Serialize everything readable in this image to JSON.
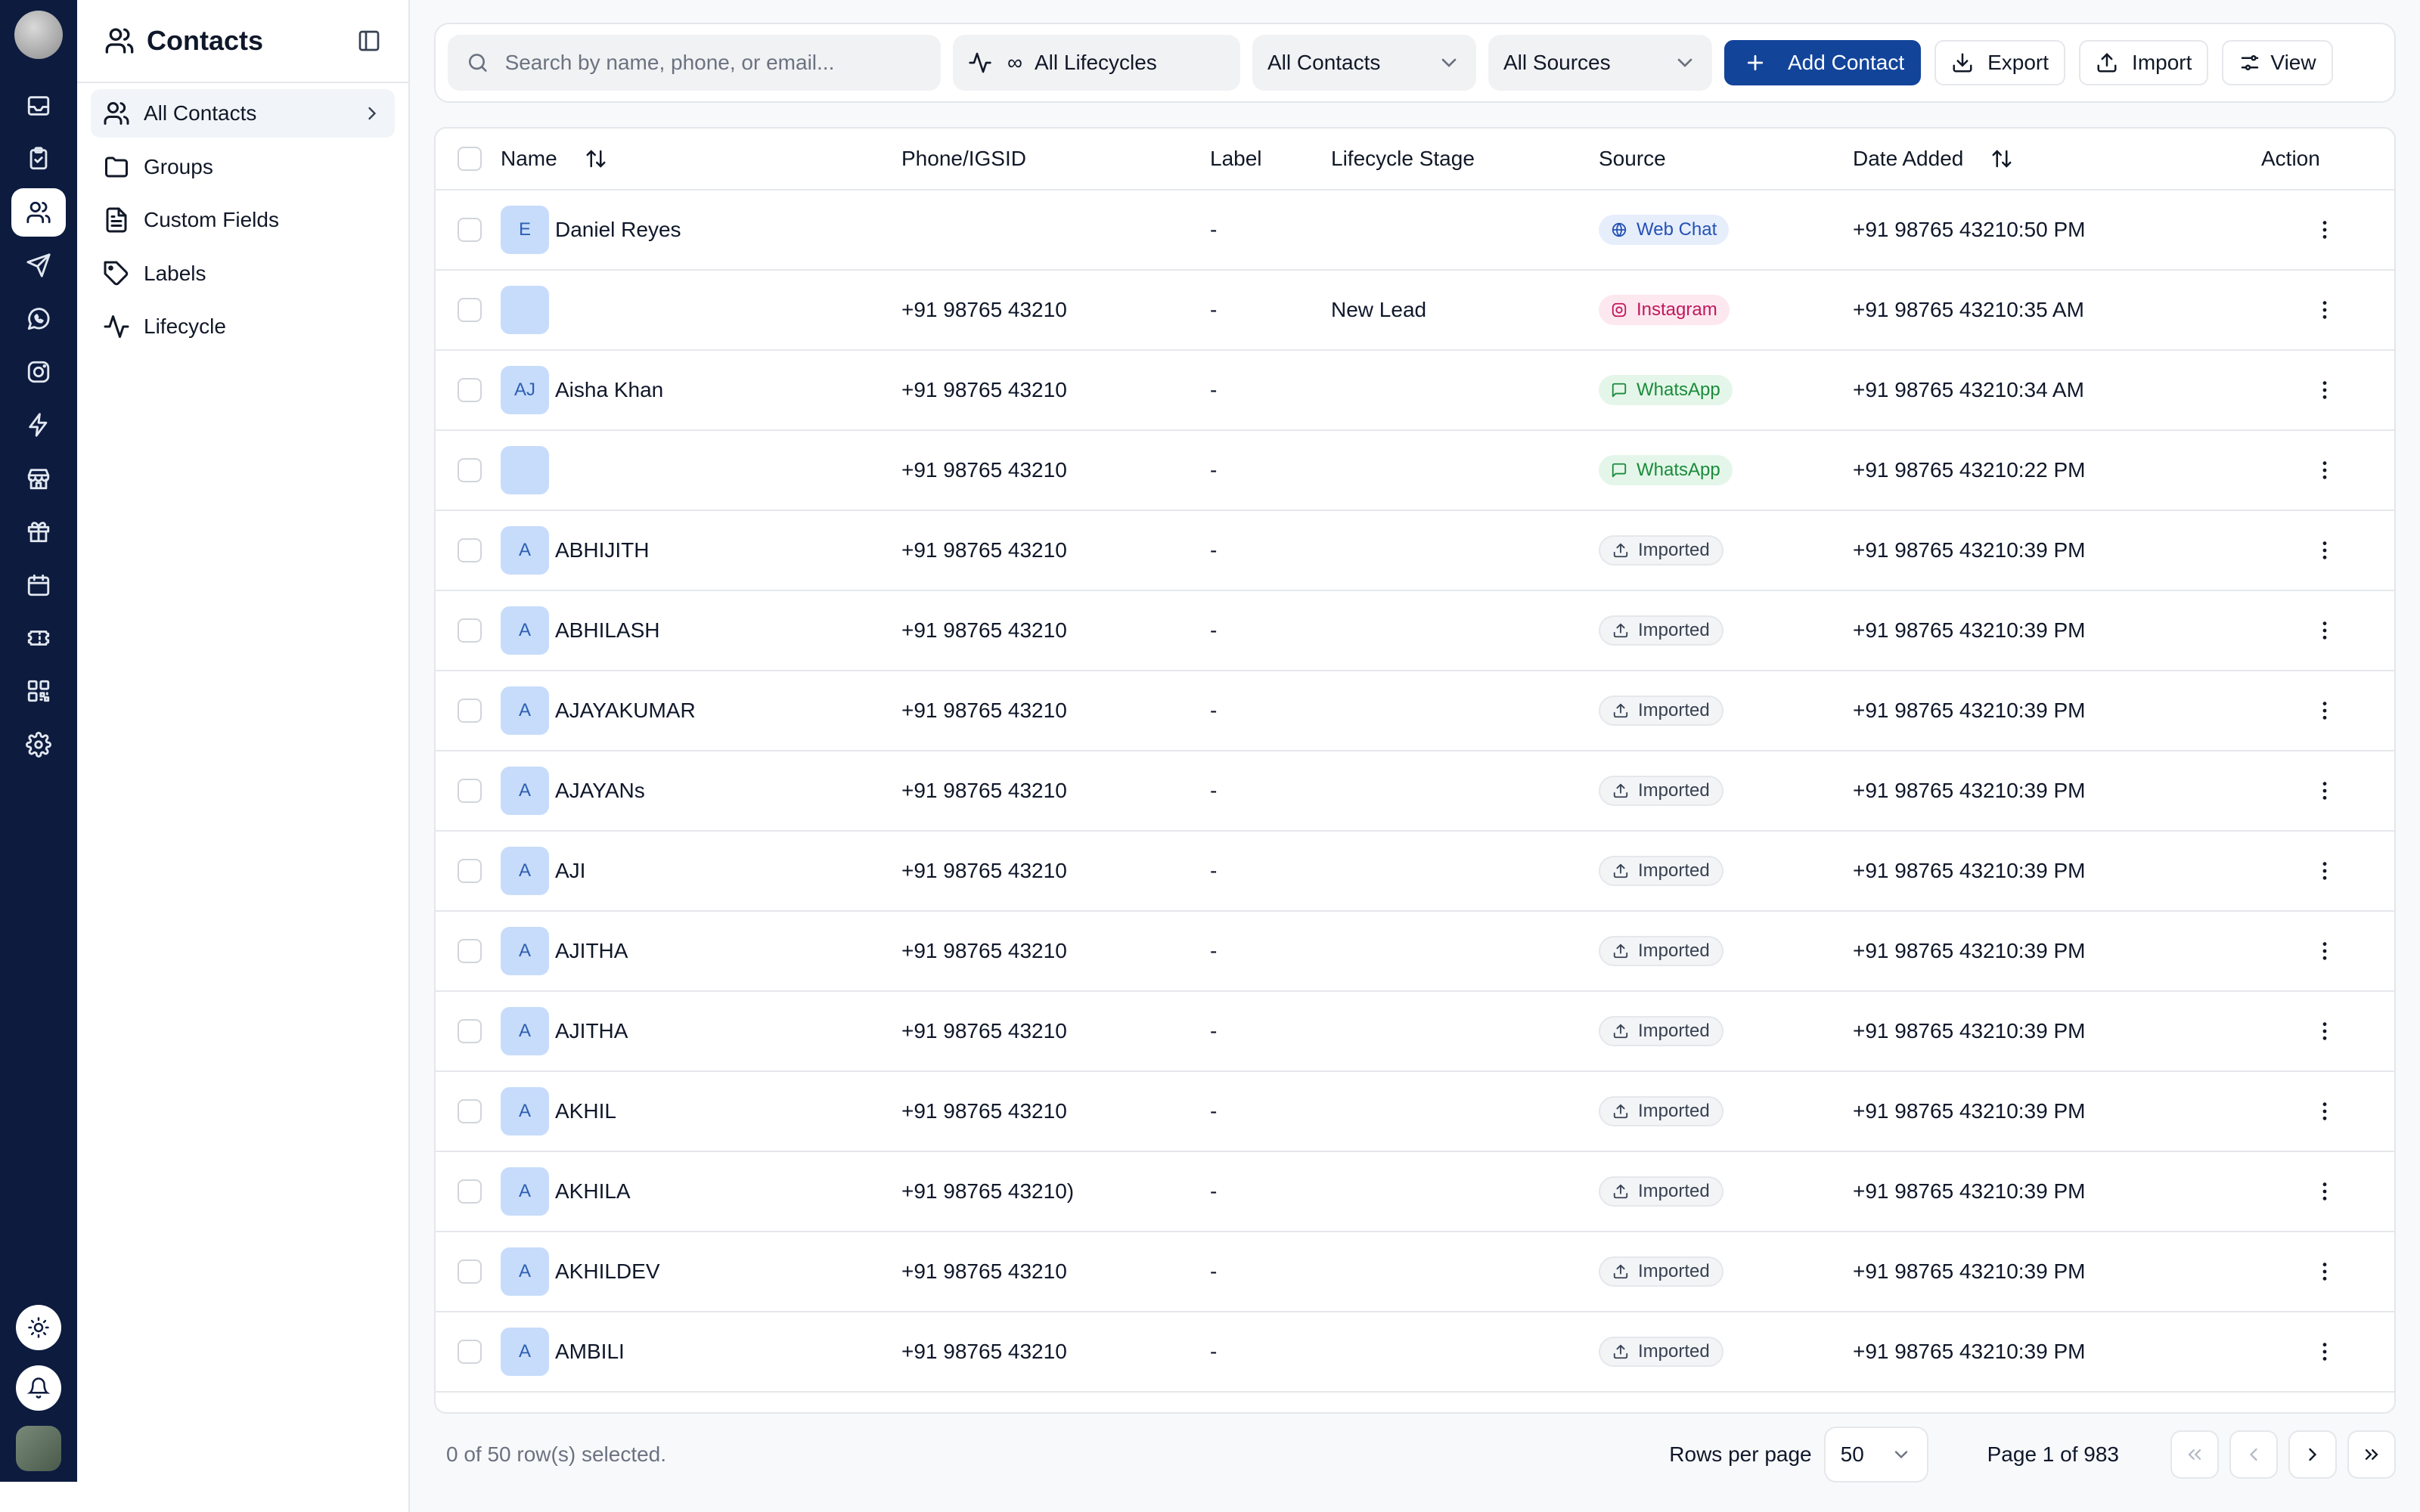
{
  "rail": {
    "icons": [
      "inbox-icon",
      "clipboard-icon",
      "contacts-icon",
      "send-icon",
      "whatsapp-icon",
      "instagram-icon",
      "zap-icon",
      "store-icon",
      "gift-icon",
      "calendar-icon",
      "ticket-icon",
      "qr-code-icon",
      "settings-icon"
    ],
    "active_index": 2
  },
  "sidebar": {
    "title": "Contacts",
    "items": [
      {
        "label": "All Contacts",
        "icon": "users-icon"
      },
      {
        "label": "Groups",
        "icon": "folder-icon"
      },
      {
        "label": "Custom Fields",
        "icon": "document-icon"
      },
      {
        "label": "Labels",
        "icon": "tag-icon"
      },
      {
        "label": "Lifecycle",
        "icon": "activity-icon"
      }
    ]
  },
  "toolbar": {
    "search_placeholder": "Search by name, phone, or email...",
    "lifecycle_filter": "All Lifecycles",
    "lifecycle_symbol": "∞",
    "contacts_filter": "All Contacts",
    "sources_filter": "All Sources",
    "add_contact": "Add Contact",
    "export": "Export",
    "import": "Import",
    "view": "View"
  },
  "table": {
    "headers": {
      "name": "Name",
      "phone": "Phone/IGSID",
      "label": "Label",
      "lifecycle": "Lifecycle Stage",
      "source": "Source",
      "date": "Date Added",
      "action": "Action"
    },
    "rows": [
      {
        "initials": "E",
        "name": "Daniel Reyes",
        "phone": "",
        "label": "-",
        "lifecycle": "",
        "source": "Web Chat",
        "source_type": "web",
        "date": "+91 98765 43210:50 PM"
      },
      {
        "initials": "",
        "name": "",
        "phone": "+91 98765 43210",
        "label": "-",
        "lifecycle": "New Lead",
        "source": "Instagram",
        "source_type": "insta",
        "date": "+91 98765 43210:35 AM"
      },
      {
        "initials": "AJ",
        "name": "Aisha Khan",
        "phone": "+91 98765 43210",
        "label": "-",
        "lifecycle": "",
        "source": "WhatsApp",
        "source_type": "whats",
        "date": "+91 98765 43210:34 AM"
      },
      {
        "initials": "",
        "name": "",
        "phone": "+91 98765 43210",
        "label": "-",
        "lifecycle": "",
        "source": "WhatsApp",
        "source_type": "whats",
        "date": "+91 98765 43210:22 PM"
      },
      {
        "initials": "A",
        "name": "ABHIJITH",
        "phone": "+91 98765 43210",
        "label": "-",
        "lifecycle": "",
        "source": "Imported",
        "source_type": "imp",
        "date": "+91 98765 43210:39 PM"
      },
      {
        "initials": "A",
        "name": "ABHILASH",
        "phone": "+91 98765 43210",
        "label": "-",
        "lifecycle": "",
        "source": "Imported",
        "source_type": "imp",
        "date": "+91 98765 43210:39 PM"
      },
      {
        "initials": "A",
        "name": "AJAYAKUMAR",
        "phone": "+91 98765 43210",
        "label": "-",
        "lifecycle": "",
        "source": "Imported",
        "source_type": "imp",
        "date": "+91 98765 43210:39 PM"
      },
      {
        "initials": "A",
        "name": "AJAYANs",
        "phone": "+91 98765 43210",
        "label": "-",
        "lifecycle": "",
        "source": "Imported",
        "source_type": "imp",
        "date": "+91 98765 43210:39 PM"
      },
      {
        "initials": "A",
        "name": "AJI",
        "phone": "+91 98765 43210",
        "label": "-",
        "lifecycle": "",
        "source": "Imported",
        "source_type": "imp",
        "date": "+91 98765 43210:39 PM"
      },
      {
        "initials": "A",
        "name": "AJITHA",
        "phone": "+91 98765 43210",
        "label": "-",
        "lifecycle": "",
        "source": "Imported",
        "source_type": "imp",
        "date": "+91 98765 43210:39 PM"
      },
      {
        "initials": "A",
        "name": "AJITHA",
        "phone": "+91 98765 43210",
        "label": "-",
        "lifecycle": "",
        "source": "Imported",
        "source_type": "imp",
        "date": "+91 98765 43210:39 PM"
      },
      {
        "initials": "A",
        "name": "AKHIL",
        "phone": "+91 98765 43210",
        "label": "-",
        "lifecycle": "",
        "source": "Imported",
        "source_type": "imp",
        "date": "+91 98765 43210:39 PM"
      },
      {
        "initials": "A",
        "name": "AKHILA",
        "phone": "+91 98765 43210)",
        "label": "-",
        "lifecycle": "",
        "source": "Imported",
        "source_type": "imp",
        "date": "+91 98765 43210:39 PM"
      },
      {
        "initials": "A",
        "name": "AKHILDEV",
        "phone": "+91 98765 43210",
        "label": "-",
        "lifecycle": "",
        "source": "Imported",
        "source_type": "imp",
        "date": "+91 98765 43210:39 PM"
      },
      {
        "initials": "A",
        "name": "AMBILI",
        "phone": "+91 98765 43210",
        "label": "-",
        "lifecycle": "",
        "source": "Imported",
        "source_type": "imp",
        "date": "+91 98765 43210:39 PM"
      }
    ]
  },
  "footer": {
    "selected": "0 of 50 row(s) selected.",
    "rows_per_page_label": "Rows per page",
    "rows_per_page": "50",
    "page_info": "Page 1 of 983"
  },
  "colors": {
    "rail_bg": "#0d1b3f",
    "primary": "#12449a",
    "avatar_chip": "#c7dcfb"
  }
}
